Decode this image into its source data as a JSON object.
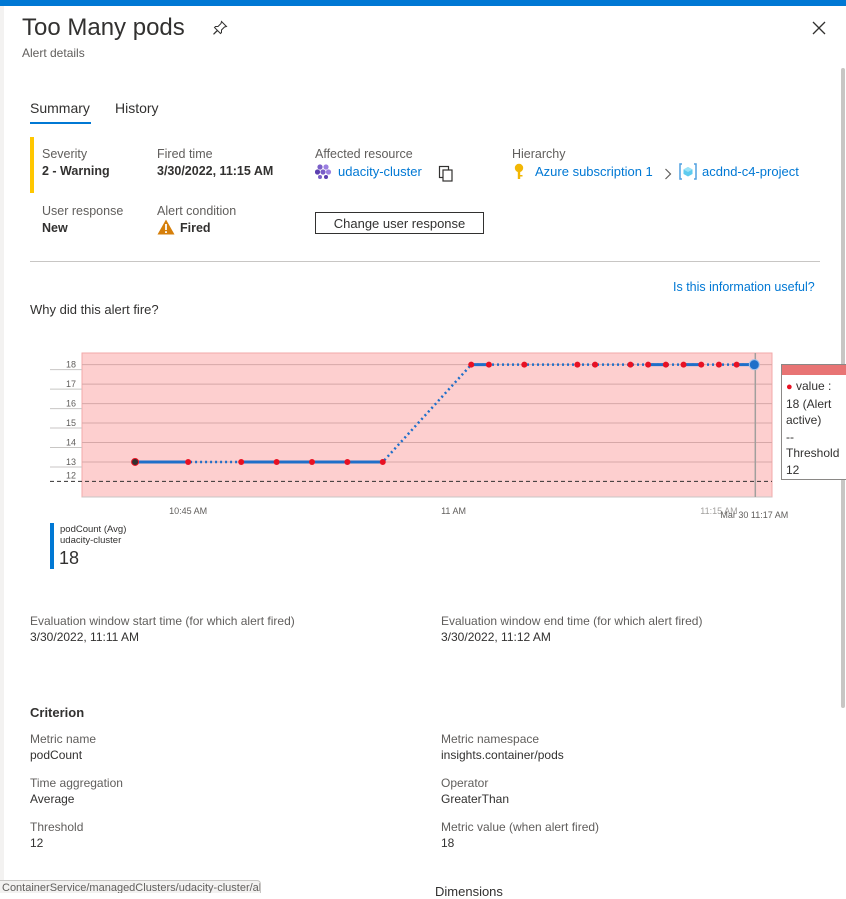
{
  "header": {
    "title": "Too Many pods",
    "subtitle": "Alert details",
    "pin_icon": "pin-icon",
    "close_icon": "close-icon"
  },
  "tabs": [
    {
      "label": "Summary",
      "active": true
    },
    {
      "label": "History",
      "active": false
    }
  ],
  "summary": {
    "severity_label": "Severity",
    "severity_value": "2 - Warning",
    "severity_color": "#ffc700",
    "fired_time_label": "Fired time",
    "fired_time_value": "3/30/2022, 11:15 AM",
    "affected_resource_label": "Affected resource",
    "affected_resource_value": "udacity-cluster",
    "hierarchy_label": "Hierarchy",
    "hierarchy_subscription": "Azure subscription 1",
    "hierarchy_group": "acdnd-c4-project",
    "user_response_label": "User response",
    "user_response_value": "New",
    "alert_condition_label": "Alert condition",
    "alert_condition_value": "Fired",
    "change_button_label": "Change user response"
  },
  "feedback_link": "Is this information useful?",
  "why_fired_title": "Why did this alert fire?",
  "chart_data": {
    "type": "line",
    "x_tick_labels": [
      "10:45 AM",
      "11 AM",
      "11:15 AM"
    ],
    "x_cursor_label": "Mar 30 11:17 AM",
    "y_ticks": [
      13,
      14,
      15,
      16,
      17,
      18
    ],
    "ylim": [
      11.2,
      18.6
    ],
    "threshold": 12,
    "series": [
      {
        "name": "podCount (Avg)",
        "color": "#1f6fc9",
        "points": [
          [
            "10:42",
            13
          ],
          [
            "10:45",
            13
          ],
          [
            "10:48",
            13
          ],
          [
            "10:50",
            13
          ],
          [
            "10:52",
            13
          ],
          [
            "10:54",
            13
          ],
          [
            "10:56",
            13
          ],
          [
            "11:01",
            18
          ],
          [
            "11:02",
            18
          ],
          [
            "11:04",
            18
          ],
          [
            "11:07",
            18
          ],
          [
            "11:08",
            18
          ],
          [
            "11:10",
            18
          ],
          [
            "11:11",
            18
          ],
          [
            "11:12",
            18
          ],
          [
            "11:13",
            18
          ],
          [
            "11:14",
            18
          ],
          [
            "11:15",
            18
          ],
          [
            "11:16",
            18
          ],
          [
            "11:17",
            18
          ]
        ]
      }
    ],
    "alert_region_color": "#fdcfcf",
    "point_color": "#e81123"
  },
  "tooltip": {
    "value_label": "value :",
    "value_text": "18 (Alert",
    "value_text2": "active)",
    "sep": "--",
    "threshold_label": "Threshold",
    "threshold_value": "12"
  },
  "legend": {
    "metric": "podCount (Avg)",
    "resource": "udacity-cluster",
    "value": "18"
  },
  "evaluation": {
    "start_label": "Evaluation window start time (for which alert fired)",
    "start_value": "3/30/2022, 11:11 AM",
    "end_label": "Evaluation window end time (for which alert fired)",
    "end_value": "3/30/2022, 11:12 AM"
  },
  "criterion": {
    "title": "Criterion",
    "metric_name_label": "Metric name",
    "metric_name_value": "podCount",
    "metric_namespace_label": "Metric namespace",
    "metric_namespace_value": "insights.container/pods",
    "time_aggregation_label": "Time aggregation",
    "time_aggregation_value": "Average",
    "operator_label": "Operator",
    "operator_value": "GreaterThan",
    "threshold_label": "Threshold",
    "threshold_value": "12",
    "metric_value_label": "Metric value (when alert fired)",
    "metric_value_value": "18"
  },
  "status_bar": {
    "url": "ContainerService/managedClusters/udacity-cluster/alerts"
  },
  "cut_off_text": "Dimensions"
}
